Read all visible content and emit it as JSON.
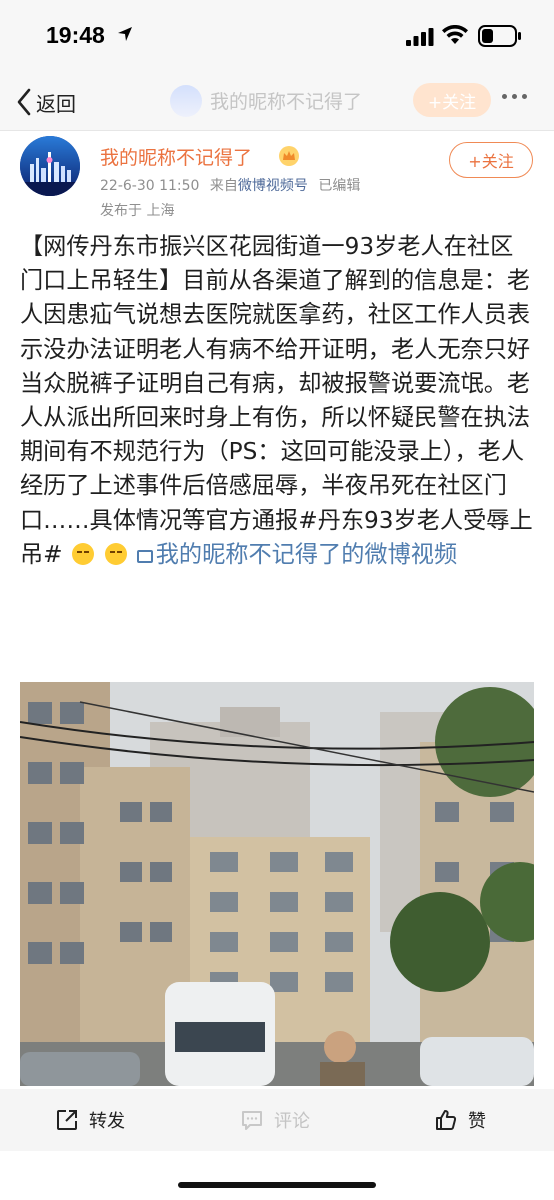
{
  "status": {
    "time": "19:48"
  },
  "nav": {
    "back_label": "返回",
    "title": "我的昵称不记得了",
    "follow_label": "+关注"
  },
  "post": {
    "username": "我的昵称不记得了",
    "follow_label": "+关注",
    "timestamp": "22-6-30 11:50",
    "source_prefix": "来自",
    "source": "微博视频号",
    "edited": "已编辑",
    "location": "发布于 上海",
    "body_text": "【网传丹东市振兴区花园街道一93岁老人在社区门口上吊轻生】目前从各渠道了解到的信息是：老人因患疝气说想去医院就医拿药，社区工作人员表示没办法证明老人有病不给开证明，老人无奈只好当众脱裤子证明自己有病，却被报警说要流氓。老人从派出所回来时身上有伤，所以怀疑民警在执法期间有不规范行为（PS：这回可能没录上），老人经历了上述事件后倍感屈辱，半夜吊死在社区门口……具体情况等官方通报#丹东93岁老人受辱上吊# ",
    "video_link": "我的昵称不记得了的微博视频"
  },
  "actions": {
    "repost": "转发",
    "comment": "评论",
    "like": "赞"
  },
  "colors": {
    "accent": "#eb7340",
    "link": "#507daf"
  }
}
